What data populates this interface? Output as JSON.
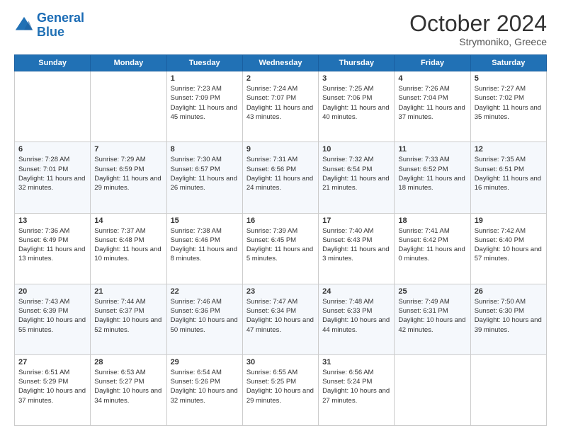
{
  "logo": {
    "general": "General",
    "blue": "Blue"
  },
  "header": {
    "month": "October 2024",
    "location": "Strymoniko, Greece"
  },
  "weekdays": [
    "Sunday",
    "Monday",
    "Tuesday",
    "Wednesday",
    "Thursday",
    "Friday",
    "Saturday"
  ],
  "weeks": [
    [
      {
        "day": null
      },
      {
        "day": null
      },
      {
        "day": "1",
        "sunrise": "7:23 AM",
        "sunset": "7:09 PM",
        "daylight": "11 hours and 45 minutes."
      },
      {
        "day": "2",
        "sunrise": "7:24 AM",
        "sunset": "7:07 PM",
        "daylight": "11 hours and 43 minutes."
      },
      {
        "day": "3",
        "sunrise": "7:25 AM",
        "sunset": "7:06 PM",
        "daylight": "11 hours and 40 minutes."
      },
      {
        "day": "4",
        "sunrise": "7:26 AM",
        "sunset": "7:04 PM",
        "daylight": "11 hours and 37 minutes."
      },
      {
        "day": "5",
        "sunrise": "7:27 AM",
        "sunset": "7:02 PM",
        "daylight": "11 hours and 35 minutes."
      }
    ],
    [
      {
        "day": "6",
        "sunrise": "7:28 AM",
        "sunset": "7:01 PM",
        "daylight": "11 hours and 32 minutes."
      },
      {
        "day": "7",
        "sunrise": "7:29 AM",
        "sunset": "6:59 PM",
        "daylight": "11 hours and 29 minutes."
      },
      {
        "day": "8",
        "sunrise": "7:30 AM",
        "sunset": "6:57 PM",
        "daylight": "11 hours and 26 minutes."
      },
      {
        "day": "9",
        "sunrise": "7:31 AM",
        "sunset": "6:56 PM",
        "daylight": "11 hours and 24 minutes."
      },
      {
        "day": "10",
        "sunrise": "7:32 AM",
        "sunset": "6:54 PM",
        "daylight": "11 hours and 21 minutes."
      },
      {
        "day": "11",
        "sunrise": "7:33 AM",
        "sunset": "6:52 PM",
        "daylight": "11 hours and 18 minutes."
      },
      {
        "day": "12",
        "sunrise": "7:35 AM",
        "sunset": "6:51 PM",
        "daylight": "11 hours and 16 minutes."
      }
    ],
    [
      {
        "day": "13",
        "sunrise": "7:36 AM",
        "sunset": "6:49 PM",
        "daylight": "11 hours and 13 minutes."
      },
      {
        "day": "14",
        "sunrise": "7:37 AM",
        "sunset": "6:48 PM",
        "daylight": "11 hours and 10 minutes."
      },
      {
        "day": "15",
        "sunrise": "7:38 AM",
        "sunset": "6:46 PM",
        "daylight": "11 hours and 8 minutes."
      },
      {
        "day": "16",
        "sunrise": "7:39 AM",
        "sunset": "6:45 PM",
        "daylight": "11 hours and 5 minutes."
      },
      {
        "day": "17",
        "sunrise": "7:40 AM",
        "sunset": "6:43 PM",
        "daylight": "11 hours and 3 minutes."
      },
      {
        "day": "18",
        "sunrise": "7:41 AM",
        "sunset": "6:42 PM",
        "daylight": "11 hours and 0 minutes."
      },
      {
        "day": "19",
        "sunrise": "7:42 AM",
        "sunset": "6:40 PM",
        "daylight": "10 hours and 57 minutes."
      }
    ],
    [
      {
        "day": "20",
        "sunrise": "7:43 AM",
        "sunset": "6:39 PM",
        "daylight": "10 hours and 55 minutes."
      },
      {
        "day": "21",
        "sunrise": "7:44 AM",
        "sunset": "6:37 PM",
        "daylight": "10 hours and 52 minutes."
      },
      {
        "day": "22",
        "sunrise": "7:46 AM",
        "sunset": "6:36 PM",
        "daylight": "10 hours and 50 minutes."
      },
      {
        "day": "23",
        "sunrise": "7:47 AM",
        "sunset": "6:34 PM",
        "daylight": "10 hours and 47 minutes."
      },
      {
        "day": "24",
        "sunrise": "7:48 AM",
        "sunset": "6:33 PM",
        "daylight": "10 hours and 44 minutes."
      },
      {
        "day": "25",
        "sunrise": "7:49 AM",
        "sunset": "6:31 PM",
        "daylight": "10 hours and 42 minutes."
      },
      {
        "day": "26",
        "sunrise": "7:50 AM",
        "sunset": "6:30 PM",
        "daylight": "10 hours and 39 minutes."
      }
    ],
    [
      {
        "day": "27",
        "sunrise": "6:51 AM",
        "sunset": "5:29 PM",
        "daylight": "10 hours and 37 minutes."
      },
      {
        "day": "28",
        "sunrise": "6:53 AM",
        "sunset": "5:27 PM",
        "daylight": "10 hours and 34 minutes."
      },
      {
        "day": "29",
        "sunrise": "6:54 AM",
        "sunset": "5:26 PM",
        "daylight": "10 hours and 32 minutes."
      },
      {
        "day": "30",
        "sunrise": "6:55 AM",
        "sunset": "5:25 PM",
        "daylight": "10 hours and 29 minutes."
      },
      {
        "day": "31",
        "sunrise": "6:56 AM",
        "sunset": "5:24 PM",
        "daylight": "10 hours and 27 minutes."
      },
      {
        "day": null
      },
      {
        "day": null
      }
    ]
  ],
  "labels": {
    "sunrise": "Sunrise: ",
    "sunset": "Sunset: ",
    "daylight": "Daylight: "
  }
}
